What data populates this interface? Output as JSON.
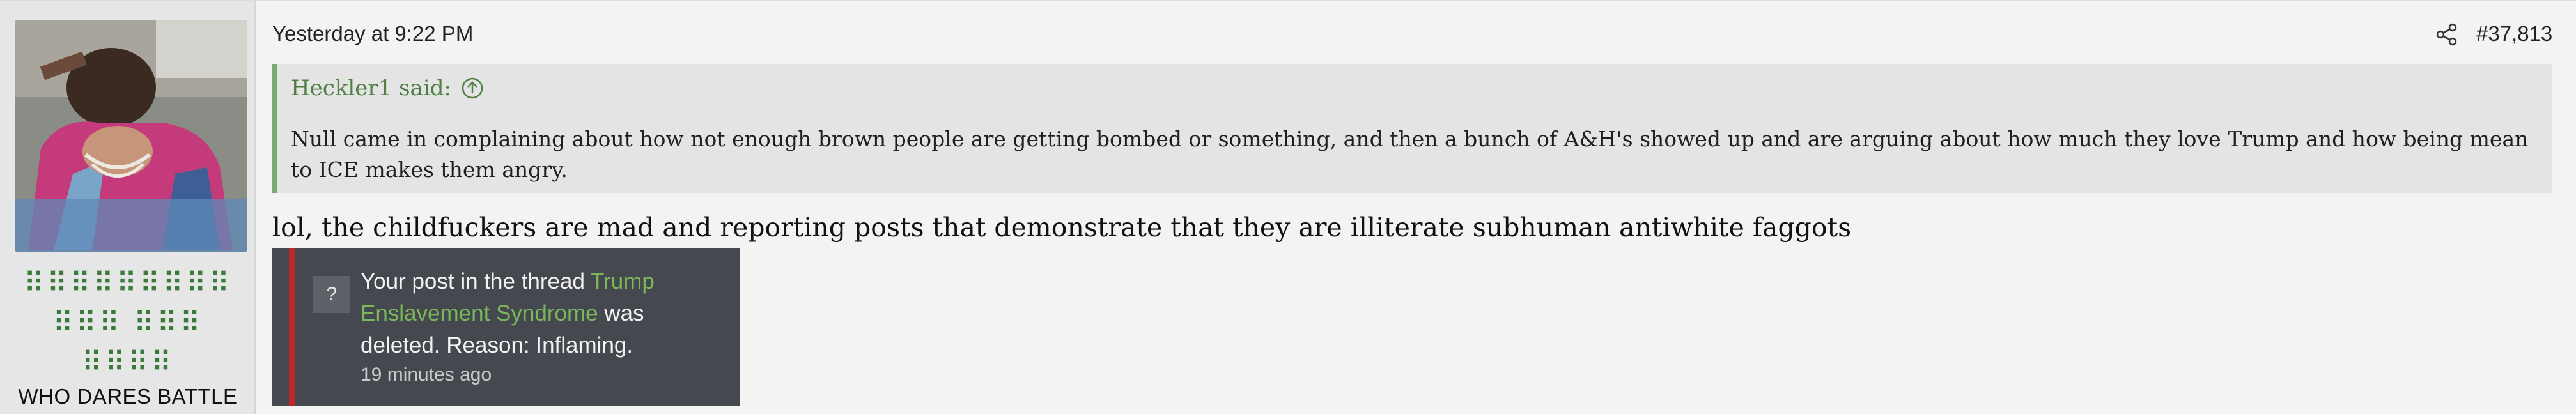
{
  "user": {
    "avatar": "avatar-image",
    "title_glyphs": [
      "⠿⠿⠿⠿⠿⠿⠿⠿⠿",
      "⠿⠿⠿ ⠿⠿⠿",
      "⠿⠿⠿⠿"
    ],
    "banner": "WHO DARES BATTLE"
  },
  "post": {
    "timestamp": "Yesterday at 9:22 PM",
    "share_icon": "share-icon",
    "number": "#37,813"
  },
  "quote": {
    "author": "Heckler1 said:",
    "jump_icon": "circle-arrow-up-icon",
    "text": "Null came in complaining about how not enough brown people are getting bombed or something, and then a bunch of A&H's showed up and are arguing about how much they love Trump and how being mean to ICE makes them angry."
  },
  "reply": {
    "text": "lol, the childfuckers are mad and reporting posts that demonstrate that they are illiterate subhuman antiwhite faggots"
  },
  "attached_screenshot": {
    "icon_glyph": "?",
    "text_before": "Your post in the thread ",
    "thread_link": "Trump Enslavement Syndrome",
    "text_after": " was deleted. Reason: Inflaming.",
    "time": "19 minutes ago"
  },
  "colors": {
    "accent_green": "#4f7f43",
    "quote_border": "#7aa86e",
    "alert_red": "#c02828",
    "alert_link": "#7ab85a"
  }
}
